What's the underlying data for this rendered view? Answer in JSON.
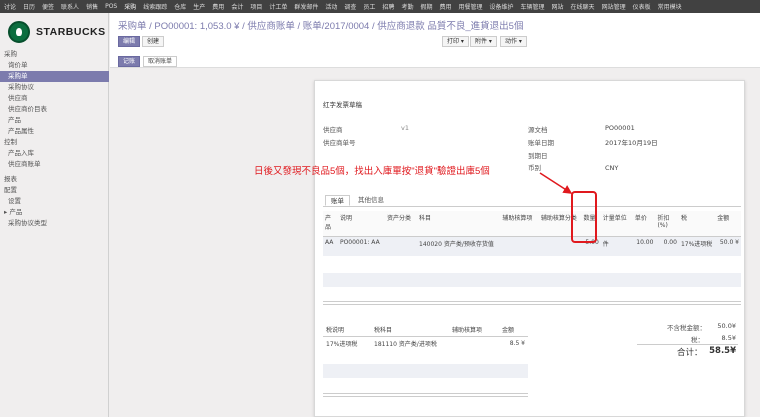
{
  "topbar": {
    "menus": [
      "讨论",
      "日历",
      "便签",
      "联系人",
      "销售",
      "POS",
      "采购",
      "线索跟踪",
      "仓库",
      "生产",
      "费用",
      "会计",
      "项目",
      "计工单",
      "群发邮件",
      "活动",
      "调查",
      "员工",
      "招聘",
      "考勤",
      "假期",
      "费用",
      "用餐管理",
      "设备维护",
      "车辆管理",
      "网站",
      "在线聊天",
      "网站管理",
      "仪表板",
      "常用模块"
    ]
  },
  "sidebar": {
    "logo": "STARBUCKS",
    "sections": [
      {
        "title": "采购",
        "items": [
          "询价单",
          "采购单",
          "采购协议",
          "供应商",
          "供应商价目表",
          "产品",
          "产品属性"
        ]
      },
      {
        "title": "控制",
        "items": [
          "产品入库",
          "供应商账单"
        ]
      },
      {
        "title": "报表",
        "items": []
      },
      {
        "title": "配置",
        "items": [
          "设置",
          "▸ 产品",
          "采购协议类型"
        ]
      }
    ],
    "active": "采购单"
  },
  "header": {
    "breadcrumb": "采购单 / PO00001: 1,053.0 ¥ / 供应商账单 / 账单/2017/0004 / 供应商退款 品質不良_進貨退出5個",
    "edit": "编辑",
    "create": "创建",
    "print": "打印 ▾",
    "attachment": "附件 ▾",
    "action": "动作 ▾",
    "status_draft": "记账",
    "status_cancel": "取消账单"
  },
  "sheet": {
    "title": "红字发票草稿",
    "labels": {
      "supplier": "供应商",
      "supplier_ref": "供应商单号",
      "source": "源文档",
      "invoice_date": "账单日期",
      "due_date": "到期日",
      "currency": "币别"
    },
    "values": {
      "supplier": "v1",
      "source": "PO00001",
      "invoice_date": "2017年10月19日",
      "currency": "CNY"
    },
    "tabs": [
      "账单",
      "其他信息"
    ],
    "line_headers": [
      "产品",
      "说明",
      "资产分类",
      "科目",
      "辅助核算项",
      "辅助核算分类",
      "数量",
      "计量单位",
      "单价",
      "折扣(%)",
      "税",
      "金额"
    ],
    "lines": [
      {
        "product": "AA",
        "desc": "PO00001: AA",
        "asset": "",
        "account": "140020 资产类/预收存货值",
        "analytic": "",
        "analytic_tag": "",
        "qty": "5.00",
        "uom": "件",
        "price": "10.00",
        "discount": "0.00",
        "tax": "17%进项税",
        "amount": "50.0 ¥"
      }
    ],
    "tax_headers": [
      "税说明",
      "税科目",
      "辅助核算项",
      "金额"
    ],
    "tax_lines": [
      {
        "desc": "17%进项税",
        "account": "181110 资产类/进项税",
        "analytic": "",
        "amount": "8.5 ¥"
      }
    ],
    "totals": {
      "untaxed_label": "不含税金额：",
      "untaxed": "50.0¥",
      "tax_label": "税：",
      "tax": "8.5¥",
      "total_label": "合计：",
      "total": "58.5¥"
    }
  },
  "annotation": {
    "text": "日後又發現不良品5個，找出入庫單按\"退貨\"驗證出庫5個",
    "color": "#e0191e"
  }
}
